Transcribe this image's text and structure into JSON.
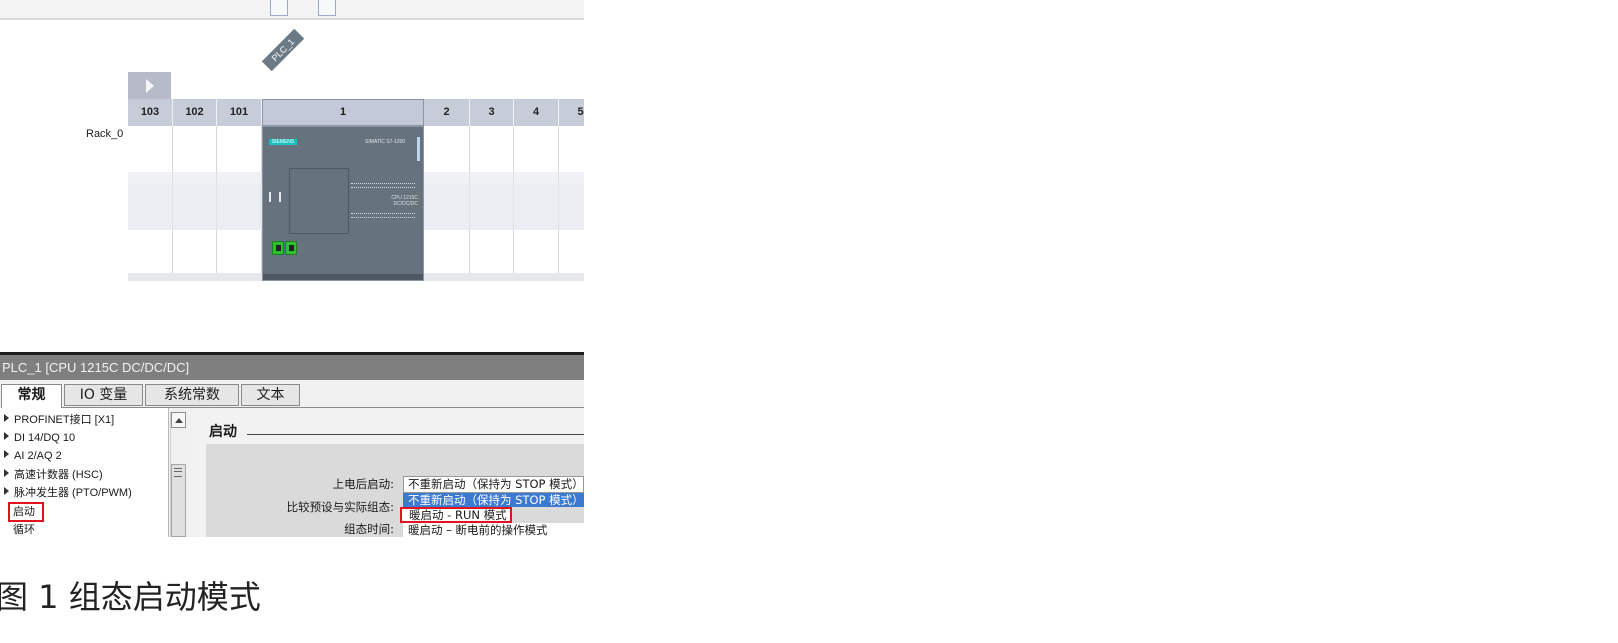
{
  "device_view": {
    "plc_tag": "PLC_1",
    "rack_label": "Rack_0",
    "slots": [
      "103",
      "102",
      "101",
      "1",
      "2",
      "3",
      "4",
      "5"
    ],
    "cpu": {
      "brand": "SIEMENS",
      "model_text": "SIMATIC S7-1200",
      "cpu_text": "CPU 1215C DC/DC/DC"
    }
  },
  "properties": {
    "title": "PLC_1 [CPU 1215C DC/DC/DC]",
    "tabs": [
      "常规",
      "IO 变量",
      "系统常数",
      "文本"
    ],
    "active_tab": "常规",
    "tree": [
      {
        "label": "PROFINET接口 [X1]",
        "expandable": true
      },
      {
        "label": "DI 14/DQ 10",
        "expandable": true
      },
      {
        "label": "AI 2/AQ 2",
        "expandable": true
      },
      {
        "label": "高速计数器 (HSC)",
        "expandable": true
      },
      {
        "label": "脉冲发生器 (PTO/PWM)",
        "expandable": true
      },
      {
        "label": "启动",
        "expandable": false,
        "highlighted": true
      },
      {
        "label": "循环",
        "expandable": false
      }
    ],
    "section_title": "启动",
    "fields": {
      "startup_label": "上电后启动:",
      "compare_label": "比较预设与实际组态:",
      "config_time_label": "组态时间:",
      "startup_value": "不重新启动（保持为 STOP 模式）"
    },
    "dropdown_options": [
      {
        "label": "不重新启动（保持为 STOP 模式）",
        "selected": true
      },
      {
        "label": "暖启动 - RUN 模式",
        "selected": false,
        "highlighted": true
      },
      {
        "label": "暖启动 – 断电前的操作模式",
        "selected": false
      }
    ]
  },
  "caption": "图 1 组态启动模式",
  "colors": {
    "highlight": "#e0141e",
    "selection": "#3c79d0",
    "cpu_body": "#66727e",
    "slot_header": "#c7ccd9"
  }
}
